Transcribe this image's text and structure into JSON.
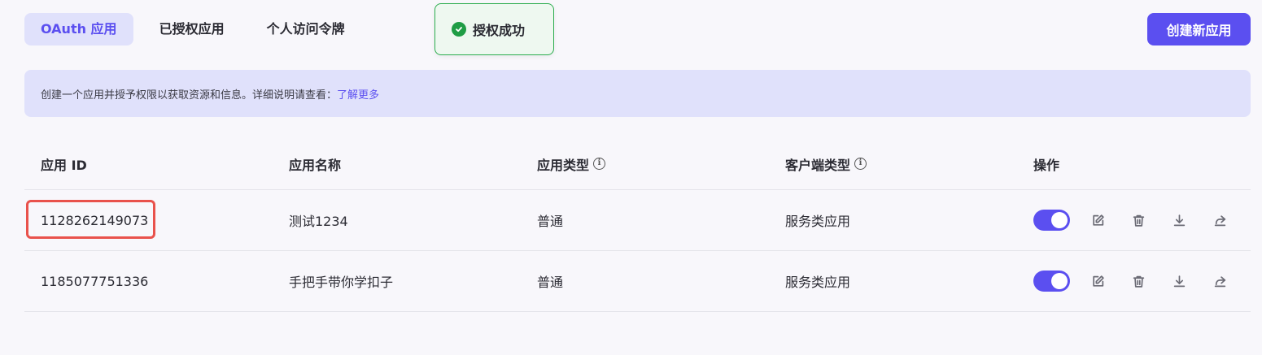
{
  "tabs": [
    {
      "label": "OAuth 应用",
      "active": true
    },
    {
      "label": "已授权应用",
      "active": false
    },
    {
      "label": "个人访问令牌",
      "active": false
    }
  ],
  "toast": {
    "message": "授权成功",
    "icon": "check-circle-icon",
    "color": "#1f9d45"
  },
  "create_button": {
    "label": "创建新应用"
  },
  "banner": {
    "text": "创建一个应用并授予权限以获取资源和信息。详细说明请查看：",
    "link": "了解更多"
  },
  "table": {
    "headers": {
      "id": "应用 ID",
      "name": "应用名称",
      "type": "应用类型",
      "client": "客户端类型",
      "ops": "操作"
    },
    "rows": [
      {
        "id": "1128262149073",
        "name": "测试1234",
        "type": "普通",
        "client": "服务类应用",
        "enabled": true,
        "highlighted": true
      },
      {
        "id": "1185077751336",
        "name": "手把手带你学扣子",
        "type": "普通",
        "client": "服务类应用",
        "enabled": true,
        "highlighted": false
      }
    ],
    "op_icons": [
      "edit-icon",
      "trash-icon",
      "download-icon",
      "share-icon"
    ]
  },
  "colors": {
    "accent": "#5b4ff0",
    "highlight": "#e9524c",
    "banner": "#e0e1fb"
  }
}
